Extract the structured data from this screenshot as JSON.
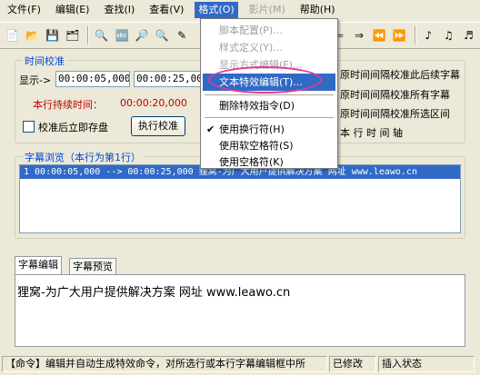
{
  "menubar": {
    "items": [
      "文件(F)",
      "编辑(E)",
      "查找(I)",
      "查看(V)",
      "格式(O)",
      "影片(M)",
      "帮助(H)"
    ]
  },
  "time_group": {
    "label": "时间校准",
    "display_label": "显示->",
    "start_time": "00:00:05,000",
    "end_time": "00:00:25,000",
    "duration_label": "本行持续时间：",
    "duration_value": "00:00:20,000",
    "save_after_checkbox_label": "校准后立即存盘",
    "calibrate_button": "执行校准",
    "option_1": "原时间间隔校准此后续字幕",
    "option_2": "原时间间隔校准所有字幕",
    "option_3": "原时间间隔校准所选区间",
    "axis_label": "本 行 时 间 轴"
  },
  "format_menu": {
    "items": [
      {
        "label": "脚本配置(P)...",
        "disabled": true
      },
      {
        "label": "样式定义(Y)...",
        "disabled": true
      },
      {
        "label": "显示方式编辑(F)...",
        "disabled": true
      },
      {
        "label": "文本特效编辑(T)...",
        "disabled": false,
        "highlighted": true
      },
      {
        "label": "删除特效指令(D)",
        "disabled": false
      },
      {
        "label": "使用换行符(H)",
        "disabled": false,
        "checked": true
      },
      {
        "label": "使用软空格符(S)",
        "disabled": false
      },
      {
        "label": "使用空格符(K)",
        "disabled": false
      }
    ]
  },
  "browse_group": {
    "label": "字幕浏览（本行为第1行）",
    "rows": [
      "1  00:00:05,000 --> 00:00:25,000  狸窝-为广大用户提供解决方案 网址 www.leawo.cn"
    ]
  },
  "tabs": {
    "edit": "字幕编辑",
    "preview": "字幕预览"
  },
  "editor": {
    "content": "狸窝-为广大用户提供解决方案  网址 www.leawo.cn"
  },
  "statusbar": {
    "command": "【命令】编辑并自动生成特效命令，对所选行或本行字幕编辑框中所",
    "modified": "已修改",
    "insert_mode": "插入状态"
  },
  "colors": {
    "accent": "#316ac5",
    "highlight_ring": "#e0389a",
    "group_label": "#0046d5",
    "duration_label": "#c00000"
  }
}
